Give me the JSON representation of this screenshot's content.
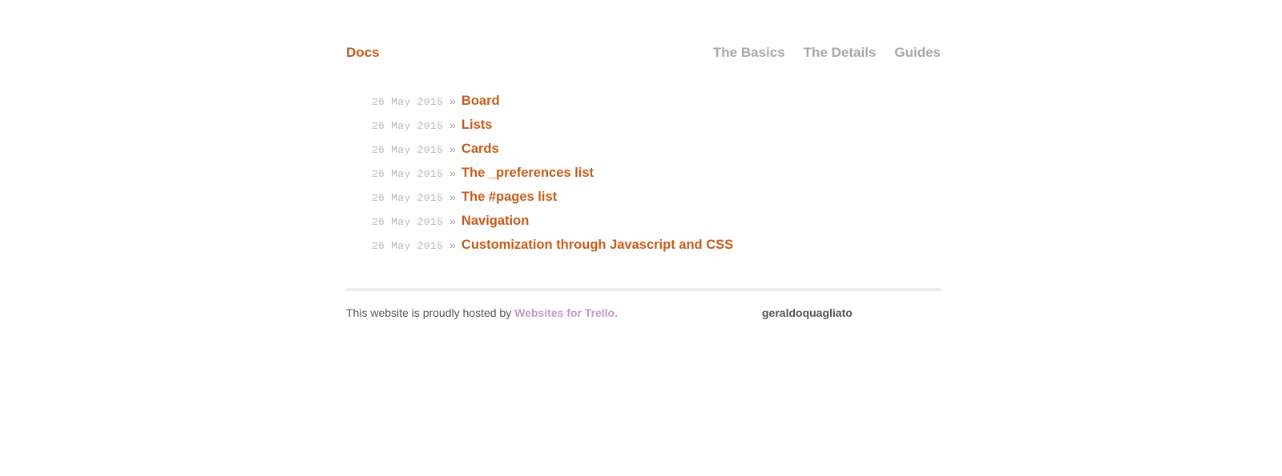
{
  "header": {
    "site_title": "Docs",
    "nav": [
      {
        "label": "The Basics"
      },
      {
        "label": "The Details"
      },
      {
        "label": "Guides"
      }
    ]
  },
  "posts": [
    {
      "date": "26 May 2015",
      "separator": "»",
      "title": "Board"
    },
    {
      "date": "26 May 2015",
      "separator": "»",
      "title": "Lists"
    },
    {
      "date": "26 May 2015",
      "separator": "»",
      "title": "Cards"
    },
    {
      "date": "26 May 2015",
      "separator": "»",
      "title": "The _preferences list"
    },
    {
      "date": "26 May 2015",
      "separator": "»",
      "title": "The #pages list"
    },
    {
      "date": "26 May 2015",
      "separator": "»",
      "title": "Navigation"
    },
    {
      "date": "26 May 2015",
      "separator": "»",
      "title": "Customization through Javascript and CSS"
    }
  ],
  "footer": {
    "host_prefix": "This website is proudly hosted by ",
    "host_link": "Websites for Trello",
    "host_suffix": ".",
    "username": "geraldoquagliato"
  },
  "colors": {
    "accent": "#c85a14",
    "nav_text": "#a8a8a8",
    "date_text": "#b8b8b8",
    "footer_link": "#c49ac8",
    "divider": "#eeeeee"
  }
}
